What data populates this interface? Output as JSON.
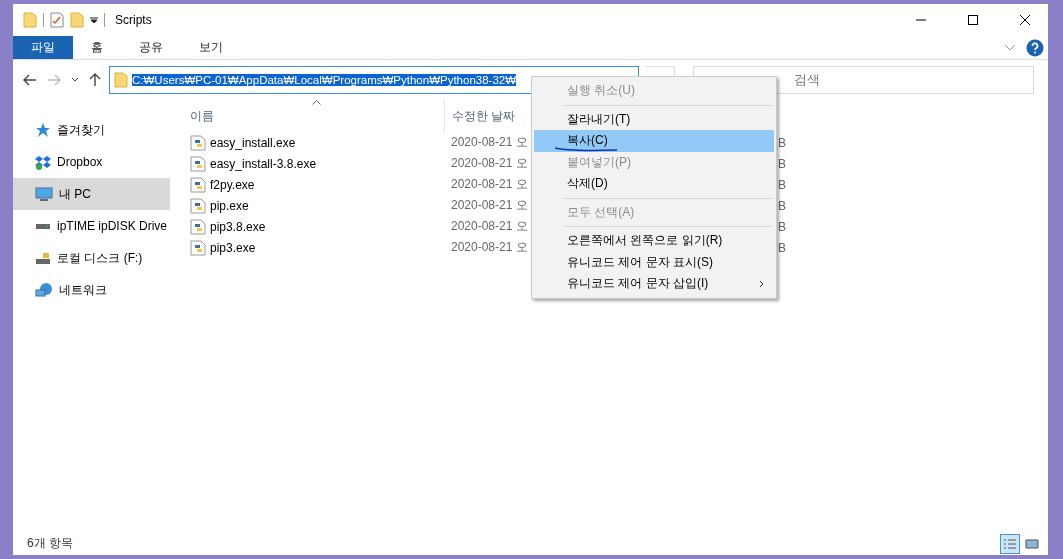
{
  "window": {
    "title": "Scripts"
  },
  "ribbon_tabs": [
    {
      "label": "파일",
      "selected": true
    },
    {
      "label": "홈",
      "selected": false
    },
    {
      "label": "공유",
      "selected": false
    },
    {
      "label": "보기",
      "selected": false
    }
  ],
  "address": {
    "path": "C:₩Users₩PC-01₩AppData₩Local₩Programs₩Python₩Python38-32₩",
    "selected": true
  },
  "search": {
    "placeholder": "검색"
  },
  "sidebar": {
    "items": [
      {
        "label": "즐겨찾기",
        "selected": false
      },
      {
        "label": "Dropbox",
        "selected": false
      },
      {
        "label": "내 PC",
        "selected": true
      },
      {
        "label": "ipTIME ipDISK Drive",
        "selected": false
      },
      {
        "label": "로컬 디스크 (F:)",
        "selected": false
      },
      {
        "label": "네트워크",
        "selected": false
      }
    ]
  },
  "table": {
    "columns": [
      "이름",
      "수정한 날짜"
    ],
    "rows": [
      {
        "name": "easy_install.exe",
        "date": "2020-08-21 오",
        "column_3": "B"
      },
      {
        "name": "easy_install-3.8.exe",
        "date": "2020-08-21 오",
        "column_3": "B"
      },
      {
        "name": "f2py.exe",
        "date": "2020-08-21 오",
        "column_3": "B"
      },
      {
        "name": "pip.exe",
        "date": "2020-08-21 오",
        "column_3": "B"
      },
      {
        "name": "pip3.8.exe",
        "date": "2020-08-21 오",
        "column_3": "B"
      },
      {
        "name": "pip3.exe",
        "date": "2020-08-21 오",
        "column_3": "B"
      }
    ]
  },
  "context_menu": {
    "items": [
      {
        "kind": "item",
        "label": "실행 취소(U)",
        "disabled": true,
        "selected": false
      },
      {
        "kind": "separator"
      },
      {
        "kind": "item",
        "label": "잘라내기(T)",
        "disabled": false,
        "selected": false
      },
      {
        "kind": "item",
        "label": "복사(C)",
        "disabled": false,
        "selected": true,
        "underlined": true
      },
      {
        "kind": "item",
        "label": "붙여넣기(P)",
        "disabled": true,
        "selected": false
      },
      {
        "kind": "item",
        "label": "삭제(D)",
        "disabled": false,
        "selected": false
      },
      {
        "kind": "separator"
      },
      {
        "kind": "item",
        "label": "모두 선택(A)",
        "disabled": true,
        "selected": false
      },
      {
        "kind": "separator"
      },
      {
        "kind": "item",
        "label": "오른쪽에서 왼쪽으로 읽기(R)",
        "disabled": false,
        "selected": false
      },
      {
        "kind": "item",
        "label": "유니코드 제어 문자 표시(S)",
        "disabled": false,
        "selected": false
      },
      {
        "kind": "item",
        "label": "유니코드 제어 문자 삽입(I)",
        "disabled": false,
        "selected": false,
        "submenu": true
      }
    ]
  },
  "status_bar": {
    "count": "6개 항목",
    "view_buttons": [
      {
        "selected": true
      },
      {
        "selected": false
      }
    ]
  }
}
